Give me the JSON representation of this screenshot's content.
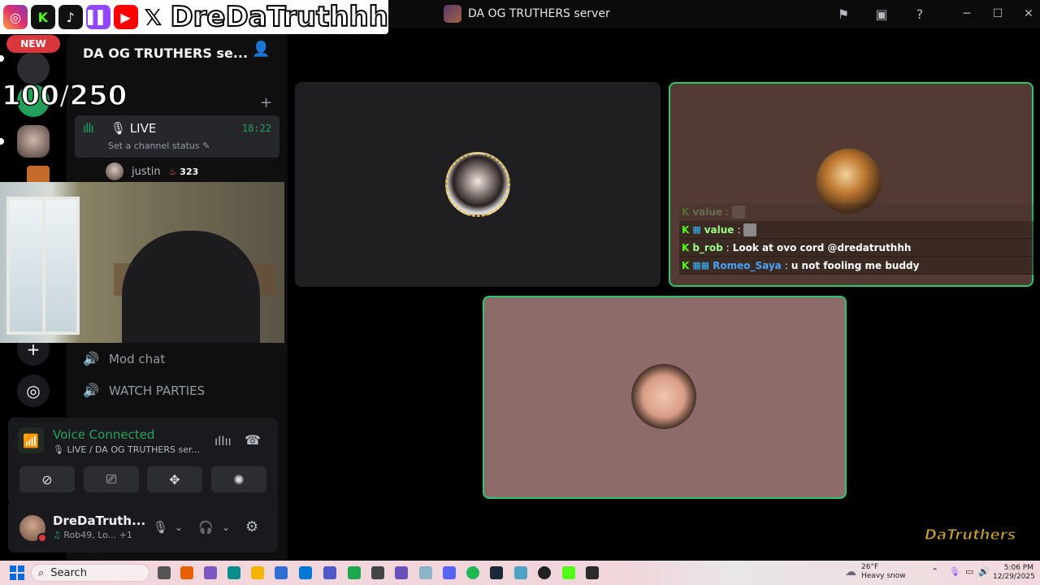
{
  "overlay": {
    "social_name": "DreDaTruthhh",
    "new_badge": "NEW",
    "counter": "100/250",
    "watermark": "DaTruthers"
  },
  "titlebar": {
    "title": "DA OG TRUTHERS server"
  },
  "sidebar": {
    "server_name": "DA OG TRUTHERS se...",
    "live_channel": {
      "name": "LIVE",
      "time": "18:22",
      "status": "Set a channel status"
    },
    "member": {
      "name": "justin",
      "badge": "323"
    },
    "channels": [
      {
        "name": "Mod chat"
      },
      {
        "name": "WATCH PARTIES"
      }
    ]
  },
  "voice_panel": {
    "title": "Voice Connected",
    "subtitle": "LIVE / DA OG TRUTHERS ser..."
  },
  "user_panel": {
    "name": "DreDaTruth...",
    "activity": "Rob49, Lo...",
    "extra": "+1"
  },
  "chat": [
    {
      "user": "value",
      "msg": "",
      "faded": true
    },
    {
      "user": "value",
      "msg": ""
    },
    {
      "user": "b_rob",
      "msg": "Look at ovo cord @dredatruthhh"
    },
    {
      "user": "Romeo_Saya",
      "msg": "u not fooling me buddy"
    }
  ],
  "taskbar": {
    "search": "Search",
    "temp": "26°F",
    "weather": "Heavy snow",
    "time": "5:06 PM",
    "date": "12/29/2025"
  },
  "colors": {
    "speaking_border": "#2dc770",
    "voice_green": "#23a55a",
    "accent_red": "#da373c"
  }
}
